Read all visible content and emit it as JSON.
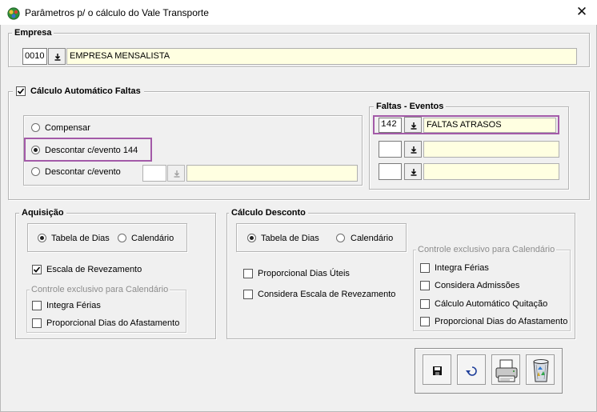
{
  "window": {
    "title": "Parâmetros p/ o cálculo do Vale Transporte",
    "close_glyph": "✕"
  },
  "empresa": {
    "label": "Empresa",
    "code": "0010",
    "name": "EMPRESA MENSALISTA"
  },
  "faltas": {
    "checkbox_label": "Cálculo Automático Faltas",
    "checked": true,
    "options": [
      {
        "label": "Compensar",
        "selected": false
      },
      {
        "label": "Descontar c/evento 144",
        "selected": true
      },
      {
        "label": "Descontar c/evento",
        "selected": false
      }
    ],
    "evento_code": "",
    "evento_name": ""
  },
  "faltas_eventos": {
    "label": "Faltas - Eventos",
    "rows": [
      {
        "code": "142",
        "name": "FALTAS ATRASOS"
      },
      {
        "code": "",
        "name": ""
      },
      {
        "code": "",
        "name": ""
      }
    ]
  },
  "aquisicao": {
    "label": "Aquisição",
    "radio_tabela": "Tabela de Dias",
    "radio_calendario": "Calendário",
    "selected": "Tabela de Dias",
    "escala_label": "Escala de Revezamento",
    "escala_checked": true,
    "controle_label": "Controle exclusivo para Calendário",
    "integra_ferias": "Integra Férias",
    "proporcional_afastamento": "Proporcional Dias do Afastamento"
  },
  "calculo_desconto": {
    "label": "Cálculo Desconto",
    "radio_tabela": "Tabela de Dias",
    "radio_calendario": "Calendário",
    "selected": "Tabela de Dias",
    "proporcional_uteis": "Proporcional Dias Úteis",
    "considera_escala": "Considera Escala de Revezamento",
    "controle_label": "Controle exclusivo para Calendário",
    "integra_ferias": "Integra Férias",
    "considera_admissoes": "Considera Admissões",
    "calculo_quitacao": "Cálculo Automático Quitação",
    "proporcional_afastamento": "Proporcional Dias do Afastamento"
  },
  "toolbar": {
    "buttons": [
      "save-icon",
      "undo-icon",
      "printer-icon",
      "recycle-bin-icon"
    ]
  },
  "colors": {
    "highlight": "#a35aa8",
    "field_bg": "#ffffe1"
  }
}
